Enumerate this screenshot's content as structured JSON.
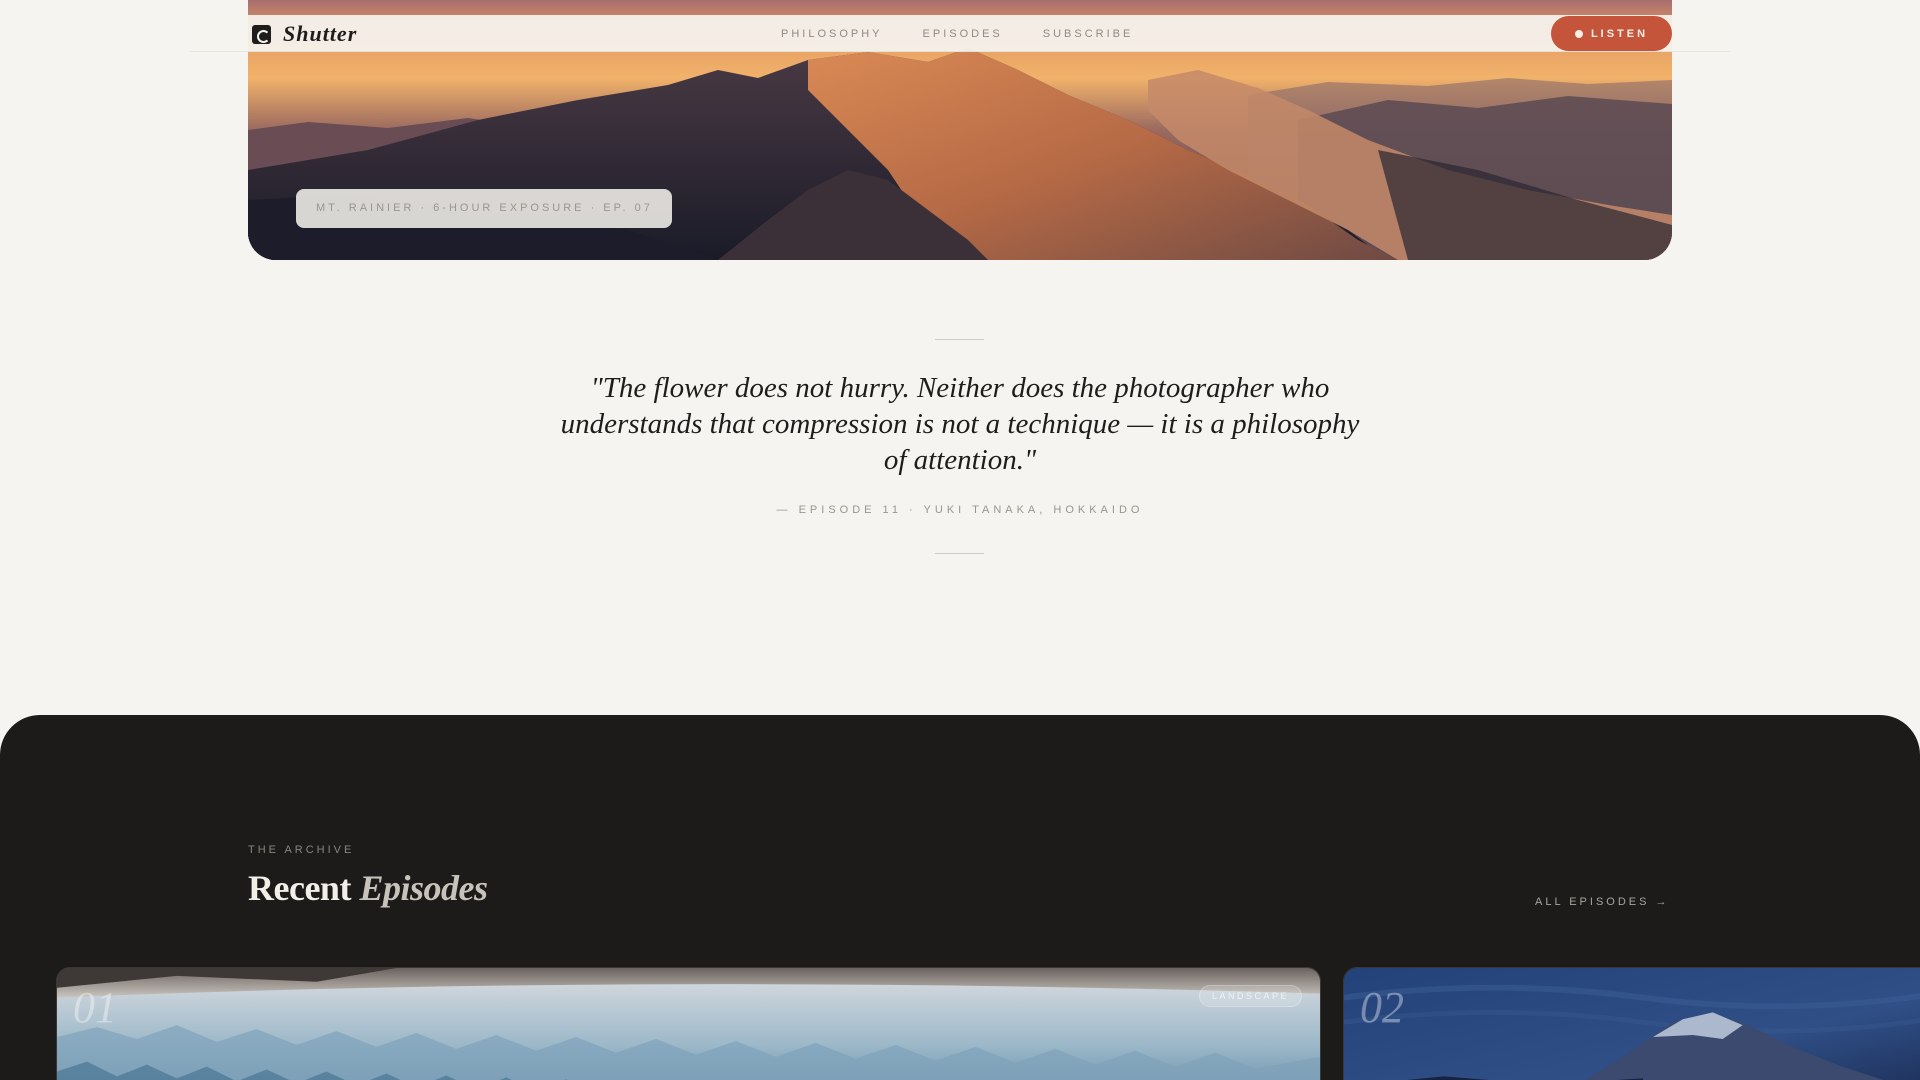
{
  "brand": {
    "name": "Shutter"
  },
  "nav": {
    "links": [
      {
        "label": "PHILOSOPHY"
      },
      {
        "label": "EPISODES"
      },
      {
        "label": "SUBSCRIBE"
      }
    ],
    "listen_label": "LISTEN"
  },
  "hero": {
    "caption": "MT. RAINIER · 6-HOUR EXPOSURE · EP. 07"
  },
  "quote": {
    "text": "\"The flower does not hurry. Neither does the photographer who understands that compression is not a technique — it is a philosophy of attention.\"",
    "attribution": "— EPISODE 11 · YUKI TANAKA, HOKKAIDO"
  },
  "archive": {
    "eyebrow": "THE ARCHIVE",
    "title_plain": "Recent",
    "title_italic": "Episodes",
    "all_link": "ALL EPISODES →",
    "cards": [
      {
        "number": "01",
        "tag": "LANDSCAPE"
      },
      {
        "number": "02"
      }
    ]
  },
  "colors": {
    "accent": "#c4553a",
    "background": "#f5f4f0",
    "dark": "#1c1b1a",
    "ink": "#1f1d1b"
  },
  "icons": {
    "brand": "shutter-aperture-icon",
    "listen": "dot-icon"
  }
}
